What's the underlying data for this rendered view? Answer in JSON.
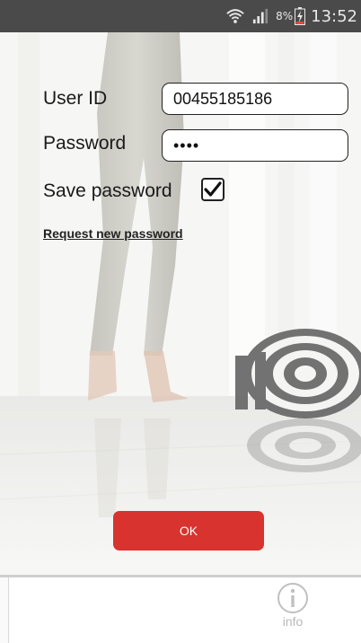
{
  "status_bar": {
    "battery_percent": "8%",
    "time": "13:52",
    "icons": [
      "wifi-icon",
      "signal-icon",
      "battery-charging-icon"
    ]
  },
  "login": {
    "user_id_label": "User ID",
    "user_id_value": "00455185186",
    "password_label": "Password",
    "password_value": "••••",
    "save_password_label": "Save password",
    "save_password_checked": true,
    "request_link": "Request new password",
    "ok_label": "OK"
  },
  "footer": {
    "info_label": "info",
    "info_icon": "info-icon"
  },
  "colors": {
    "status_bar": "#4a4a4a",
    "accent_button": "#d8332e",
    "info_gray": "#b9b9b9"
  }
}
